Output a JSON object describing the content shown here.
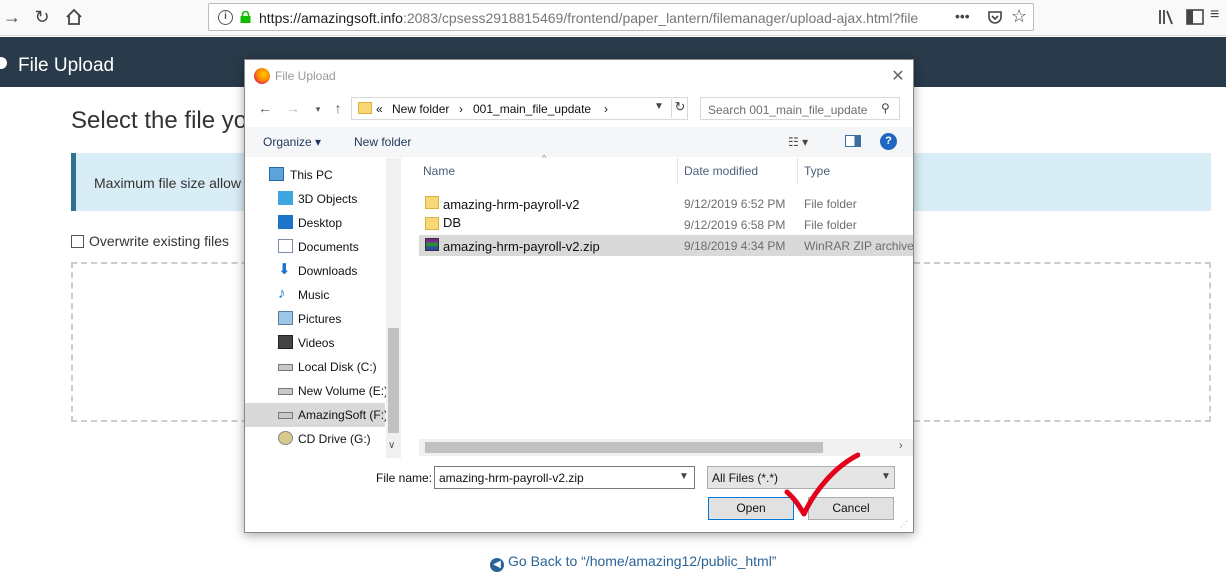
{
  "browser": {
    "url_host": "https://amazingsoft.info",
    "url_rest": ":2083/cpsess2918815469/frontend/paper_lantern/filemanager/upload-ajax.html?file",
    "overflow_menu": "•••"
  },
  "page": {
    "header_title": "File Upload",
    "heading": "Select the file yo",
    "alert_text": "Maximum file size allow",
    "overwrite_label": "Overwrite existing files",
    "go_back": "Go Back to “/home/amazing12/public_html”"
  },
  "dialog": {
    "title": "File Upload",
    "breadcrumb": [
      "«",
      "New folder",
      "›",
      "001_main_file_update",
      "›"
    ],
    "search_placeholder": "Search 001_main_file_update",
    "organize_label": "Organize ▾",
    "new_folder_label": "New folder",
    "nav_items": [
      {
        "label": "This PC",
        "icon": "pc-icon"
      },
      {
        "label": "3D Objects",
        "icon": "cube-icon"
      },
      {
        "label": "Desktop",
        "icon": "desktop-icon"
      },
      {
        "label": "Documents",
        "icon": "documents-icon"
      },
      {
        "label": "Downloads",
        "icon": "download-icon"
      },
      {
        "label": "Music",
        "icon": "music-icon"
      },
      {
        "label": "Pictures",
        "icon": "pictures-icon"
      },
      {
        "label": "Videos",
        "icon": "videos-icon"
      },
      {
        "label": "Local Disk (C:)",
        "icon": "drive-icon"
      },
      {
        "label": "New Volume (E:)",
        "icon": "drive-icon"
      },
      {
        "label": "AmazingSoft (F:)",
        "icon": "drive-icon",
        "selected": true
      },
      {
        "label": "CD Drive (G:)",
        "icon": "cd-icon"
      }
    ],
    "columns": {
      "name": "Name",
      "date": "Date modified",
      "type": "Type"
    },
    "files": [
      {
        "name": "amazing-hrm-payroll-v2",
        "date": "9/12/2019 6:52 PM",
        "type": "File folder",
        "icon": "folder-icon"
      },
      {
        "name": "DB",
        "date": "9/12/2019 6:58 PM",
        "type": "File folder",
        "icon": "folder-icon"
      },
      {
        "name": "amazing-hrm-payroll-v2.zip",
        "date": "9/18/2019 4:34 PM",
        "type": "WinRAR ZIP archive",
        "icon": "winrar-icon",
        "selected": true
      }
    ],
    "file_name_label": "File name:",
    "file_name_value": "amazing-hrm-payroll-v2.zip",
    "filter_value": "All Files (*.*)",
    "open_label": "Open",
    "cancel_label": "Cancel"
  },
  "colors": {
    "header_bg": "#293a4a",
    "alert_bg": "#d9edf7",
    "checkmark": "#e3001b"
  }
}
